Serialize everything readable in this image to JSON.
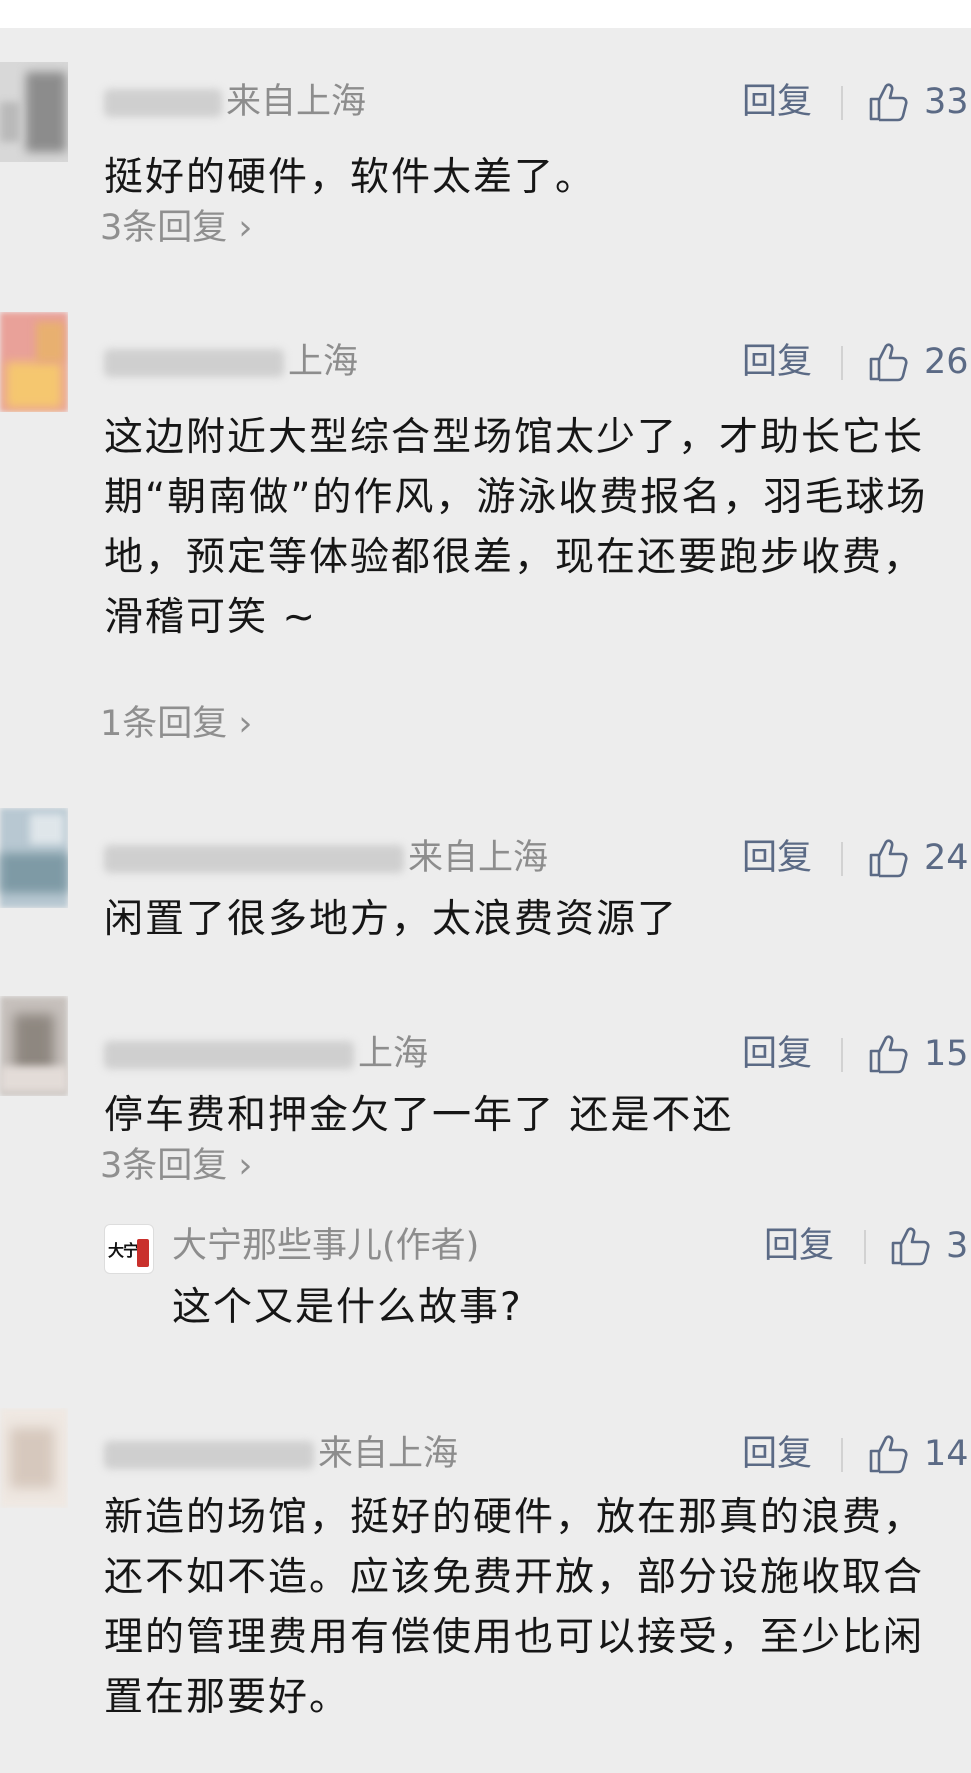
{
  "comments": [
    {
      "name_suffix": "来自上海",
      "reply_label": "回复",
      "likes": "33",
      "text": "挺好的硬件，软件太差了。",
      "more": "3条回复 ›"
    },
    {
      "name_suffix": "上海",
      "reply_label": "回复",
      "likes": "26",
      "text": "这边附近大型综合型场馆太少了，才助长它长期“朝南做”的作风，游泳收费报名，羽毛球场地，预定等体验都很差，现在还要跑步收费，滑稽可笑 ~",
      "more": "1条回复 ›"
    },
    {
      "name_suffix": "来自上海",
      "reply_label": "回复",
      "likes": "24",
      "text": "闲置了很多地方，太浪费资源了"
    },
    {
      "name_suffix": "上海",
      "reply_label": "回复",
      "likes": "15",
      "text": "停车费和押金欠了一年了 还是不还",
      "more": "3条回复 ›",
      "sub_reply": {
        "name": "大宁那些事儿(作者)",
        "reply_label": "回复",
        "likes": "3",
        "text": "这个又是什么故事?",
        "avatar_glyph": "大宁"
      }
    },
    {
      "name_suffix": "来自上海",
      "reply_label": "回复",
      "likes": "14",
      "text": "新造的场馆，挺好的硬件，放在那真的浪费，还不如不造。应该免费开放，部分设施收取合理的管理费用有偿使用也可以接受，至少比闲置在那要好。"
    }
  ]
}
